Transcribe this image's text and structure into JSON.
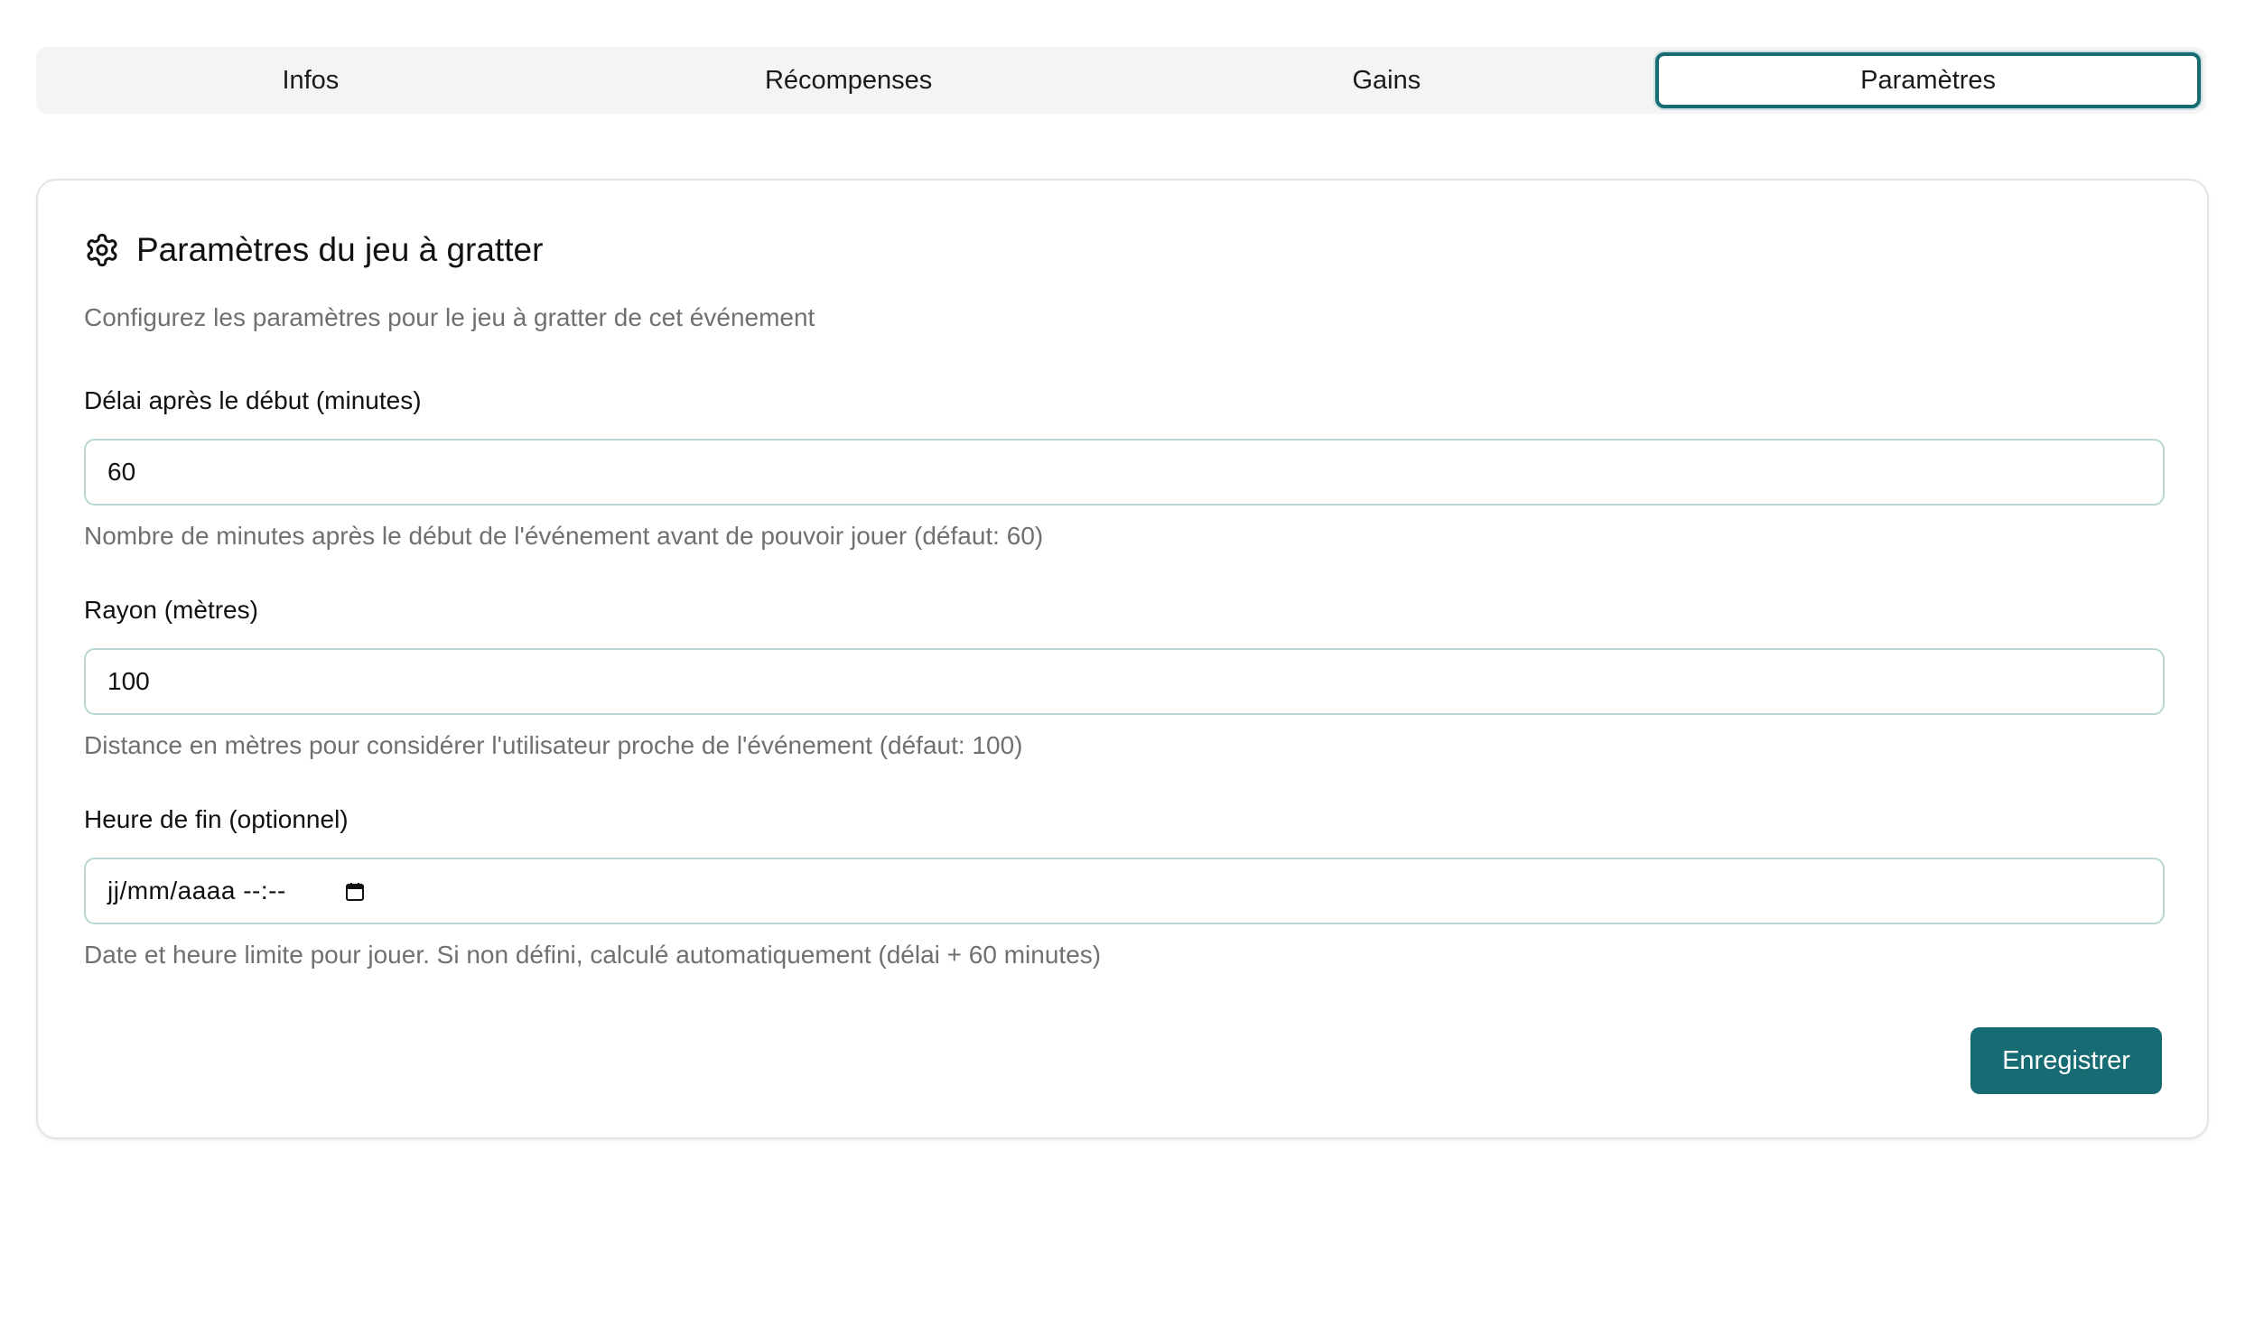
{
  "tabs": [
    {
      "label": "Infos",
      "active": false
    },
    {
      "label": "Récompenses",
      "active": false
    },
    {
      "label": "Gains",
      "active": false
    },
    {
      "label": "Paramètres",
      "active": true
    }
  ],
  "settings": {
    "title": "Paramètres du jeu à gratter",
    "icon": "gear-icon",
    "subtitle": "Configurez les paramètres pour le jeu à gratter de cet événement",
    "delay": {
      "label": "Délai après le début (minutes)",
      "value": "60",
      "hint": "Nombre de minutes après le début de l'événement avant de pouvoir jouer (défaut: 60)"
    },
    "radius": {
      "label": "Rayon (mètres)",
      "value": "100",
      "hint": "Distance en mètres pour considérer l'utilisateur proche de l'événement (défaut: 100)"
    },
    "end_time": {
      "label": "Heure de fin (optionnel)",
      "placeholder": "jj/mm/aaaa --:--",
      "hint": "Date et heure limite pour jouer. Si non défini, calculé automatiquement (délai + 60 minutes)"
    },
    "save_label": "Enregistrer"
  },
  "colors": {
    "accent": "#176b73",
    "field_border": "#b9d6d4",
    "muted_text": "#707070"
  }
}
